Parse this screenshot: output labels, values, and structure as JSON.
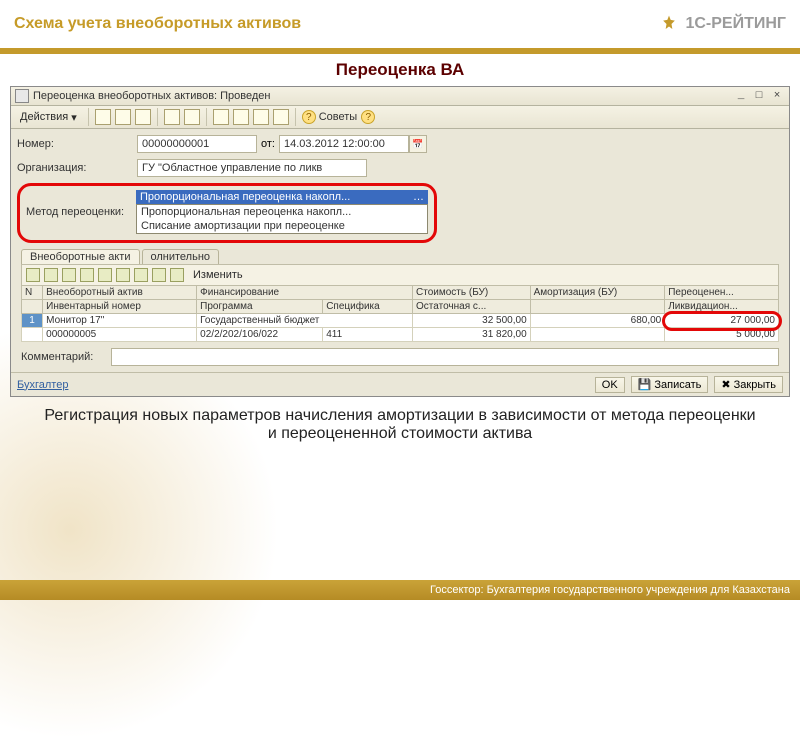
{
  "slide": {
    "title": "Схема учета внеоборотных активов",
    "brand": "1С-РЕЙТИНГ",
    "section_title": "Переоценка ВА",
    "desc": "Регистрация новых параметров начисления амортизации в зависимости от метода переоценки и переоцененной стоимости актива",
    "footer": "Госсектор: Бухгалтерия государственного учреждения для Казахстана"
  },
  "window": {
    "title": "Переоценка внеоборотных активов: Проведен",
    "actions_label": "Действия",
    "advice_label": "Советы",
    "min": "_",
    "restore": "□",
    "close": "×"
  },
  "form": {
    "number_label": "Номер:",
    "number_value": "00000000001",
    "from_label": "от:",
    "date_value": "14.03.2012 12:00:00",
    "org_label": "Организация:",
    "org_value": "ГУ \"Областное управление по ликв",
    "method_label": "Метод переоценки:",
    "dropdown_selected": "Пропорциональная переоценка накопл...",
    "dropdown_items": [
      "Пропорциональная переоценка накопл...",
      "Списание амортизации при переоценке"
    ],
    "comment_label": "Комментарий:",
    "comment_value": ""
  },
  "tabs": {
    "main": "Внеоборотные акти",
    "addl": "олнительно"
  },
  "subtoolbar": {
    "edit": "Изменить"
  },
  "table": {
    "headers1": [
      "N",
      "Внеоборотный актив",
      "Финансирование",
      "",
      "Стоимость (БУ)",
      "Амортизация (БУ)",
      "Переоценен..."
    ],
    "headers2": [
      "",
      "Инвентарный номер",
      "Программа",
      "Специфика",
      "Остаточная с...",
      "",
      "Ликвидацион..."
    ],
    "row1": {
      "n": "1",
      "asset": "Монитор 17\"",
      "fin": "Государственный бюджет",
      "spec": "",
      "cost": "32 500,00",
      "amort": "680,00",
      "reval": "27 000,00"
    },
    "row2": {
      "n": "",
      "inv": "000000005",
      "prog": "02/2/202/106/022",
      "spec": "411",
      "rest": "31 820,00",
      "amort": "",
      "liq": "5 000,00"
    }
  },
  "statusbar": {
    "user": "Бухгалтер",
    "ok": "OK",
    "save": "Записать",
    "close": "Закрыть"
  }
}
